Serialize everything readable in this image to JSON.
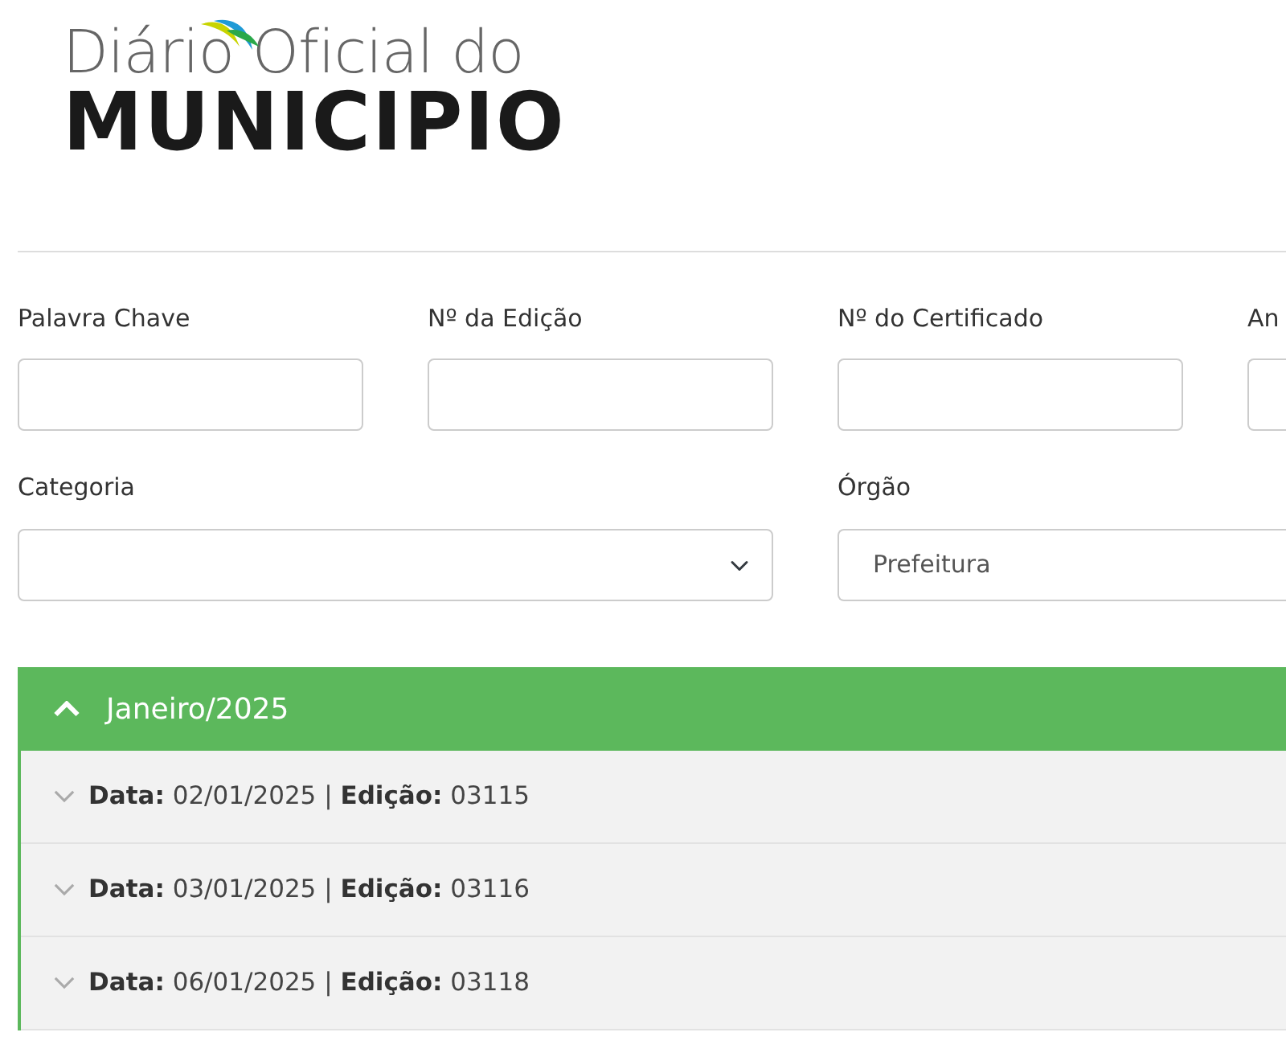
{
  "logo": {
    "line_1": "Diário Oficial do",
    "line_2": "MUNICIPIO"
  },
  "filters": [
    {
      "kind": "text",
      "label": "Palavra Chave"
    },
    {
      "kind": "text",
      "label": "Nº da Edição"
    },
    {
      "kind": "text",
      "label": "Nº do Certificado"
    },
    {
      "kind": "text",
      "label": "An"
    }
  ],
  "selects": [
    {
      "label": "Categoria"
    },
    {
      "label": "Órgão",
      "value": "Prefeitura"
    }
  ],
  "month": {
    "title": "Janeiro/2025",
    "expanded": true,
    "editions": [
      {
        "text": "**Data:** 02/01/2025 | **Edição:** 03115",
        "expanded": false
      },
      {
        "text": "**Data:** 03/01/2025 | **Edição:** 03116",
        "expanded": false
      },
      {
        "text": "**Data:** 06/01/2025 | **Edição:** 03118",
        "expanded": false
      }
    ]
  }
}
